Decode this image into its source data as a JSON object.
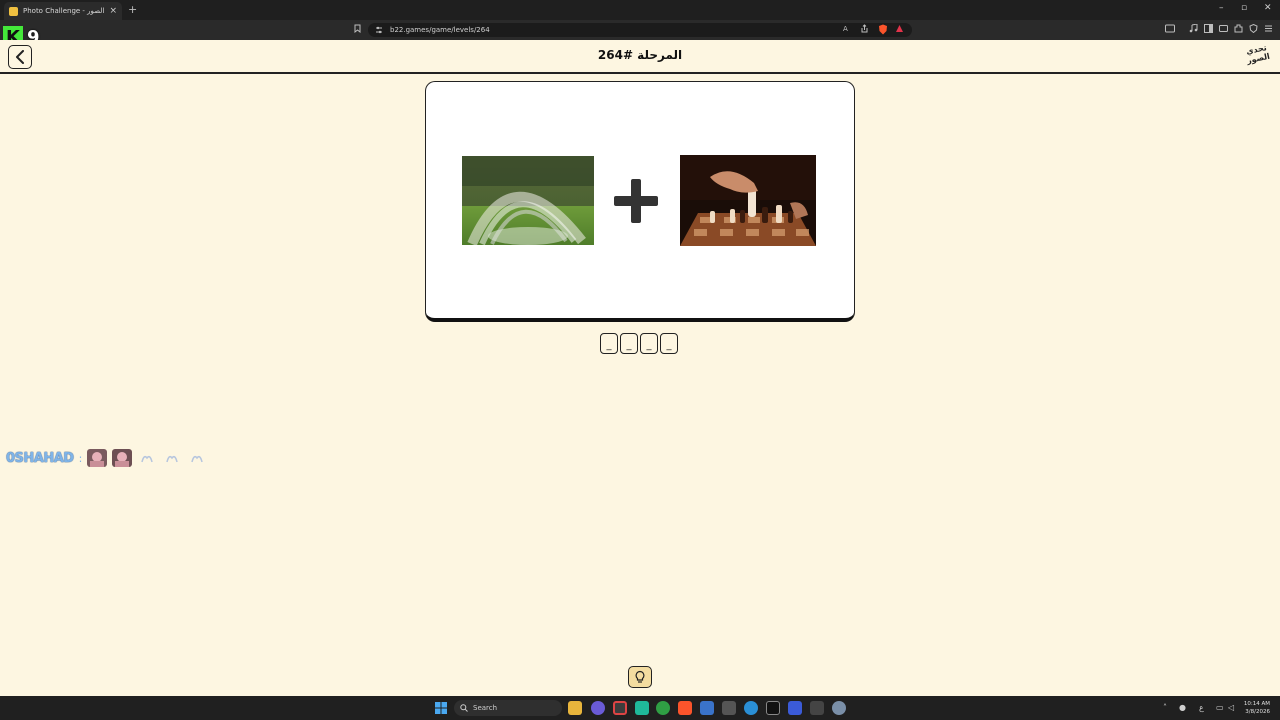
{
  "browser": {
    "tab_title": "Photo Challenge - تحدي الصور",
    "tab_close": "×",
    "new_tab": "+",
    "url": "b22.games/game/levels/264",
    "win_min": "–",
    "win_max": "▫",
    "win_close": "✕"
  },
  "overlay": {
    "k_letter": "K",
    "count": "9"
  },
  "header": {
    "level_title": "المرحلة #264",
    "logo_text": "تحدي الصور"
  },
  "puzzle": {
    "operator": "+",
    "slots": [
      "_",
      "_",
      "_",
      "_"
    ]
  },
  "chat": {
    "username": "0SHAHAD",
    "colon": ":"
  },
  "taskbar": {
    "search_label": "Search",
    "time": "10:14 AM",
    "date": "3/8/2026",
    "lang": "ع"
  },
  "colors": {
    "page_bg": "#fdf6e1",
    "hint_bg": "#f3dca0",
    "chat_name": "#7fb4e8",
    "overlay_green": "#44e83a"
  }
}
